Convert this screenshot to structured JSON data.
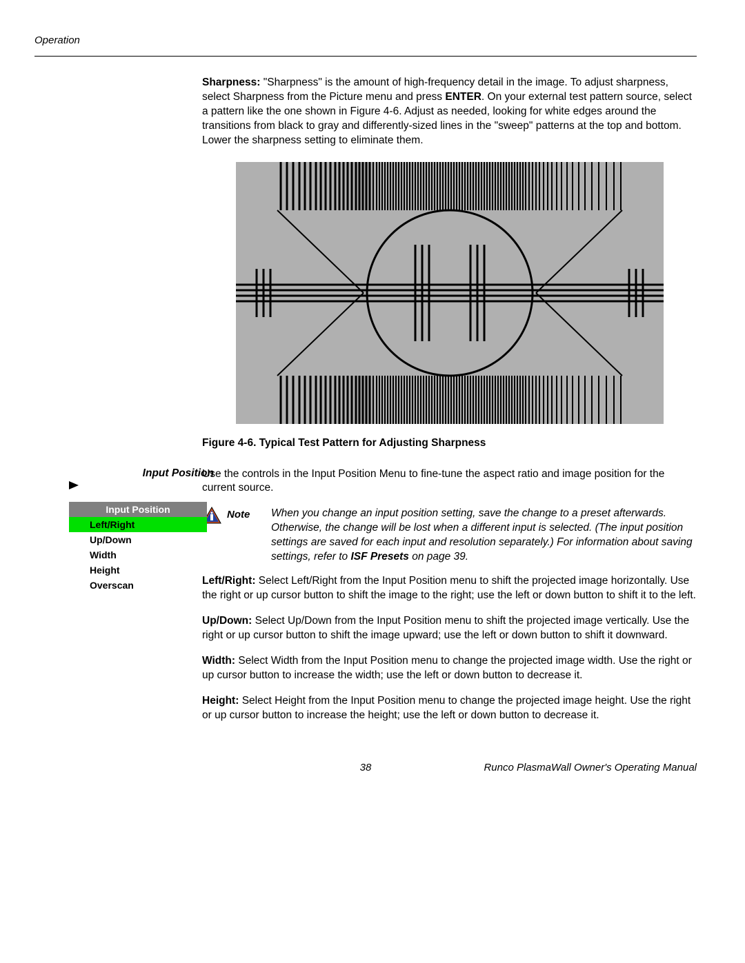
{
  "header": "Operation",
  "sharpness": {
    "label": "Sharpness:",
    "text1": " \"Sharpness\" is the amount of high-frequency detail in the image. To adjust sharpness, select Sharpness from the Picture menu and press ",
    "enter": "ENTER",
    "text2": ". On your external test pattern source, select a pattern like the one shown in Figure 4-6. Adjust as needed, looking for white edges around the transitions from black to gray and differently-sized lines in the \"sweep\" patterns at the top and bottom. Lower the sharpness setting to eliminate them."
  },
  "figure_caption": "Figure 4-6. Typical Test Pattern for Adjusting Sharpness",
  "side": {
    "title": "Input Position",
    "menu_title": "Input Position",
    "items": [
      "Left/Right",
      "Up/Down",
      "Width",
      "Height",
      "Overscan"
    ]
  },
  "input_position_intro": "Use the controls in the Input Position Menu to fine-tune the aspect ratio and image position for the current source.",
  "note": {
    "label": "Note",
    "text1": "When you change an input position setting, save the change to a preset afterwards. Otherwise, the change will be lost when a different input is selected. (The input position settings are saved for each input and resolution separately.) For information about saving settings, refer to ",
    "bold": "ISF Presets",
    "text2": " on page 39."
  },
  "lr": {
    "label": "Left/Right:",
    "text": " Select Left/Right from the Input Position menu to shift the projected image horizontally. Use the right or up cursor button to shift the image to the right; use the left or down button to shift it to the left."
  },
  "ud": {
    "label": "Up/Down:",
    "text": " Select Up/Down from the Input Position menu to shift the projected image vertically. Use the right or up cursor button to shift the image upward; use the left or down button to shift it downward."
  },
  "width": {
    "label": "Width:",
    "text": " Select Width from the Input Position menu to change the projected image width. Use the right or up cursor button to increase the width; use the left or down button to decrease it."
  },
  "height": {
    "label": "Height:",
    "text": " Select Height from the Input Position menu to change the projected image height. Use the right or up cursor button to increase the height; use the left or down button to decrease it."
  },
  "footer": {
    "page": "38",
    "title": "Runco PlasmaWall Owner's Operating Manual"
  }
}
